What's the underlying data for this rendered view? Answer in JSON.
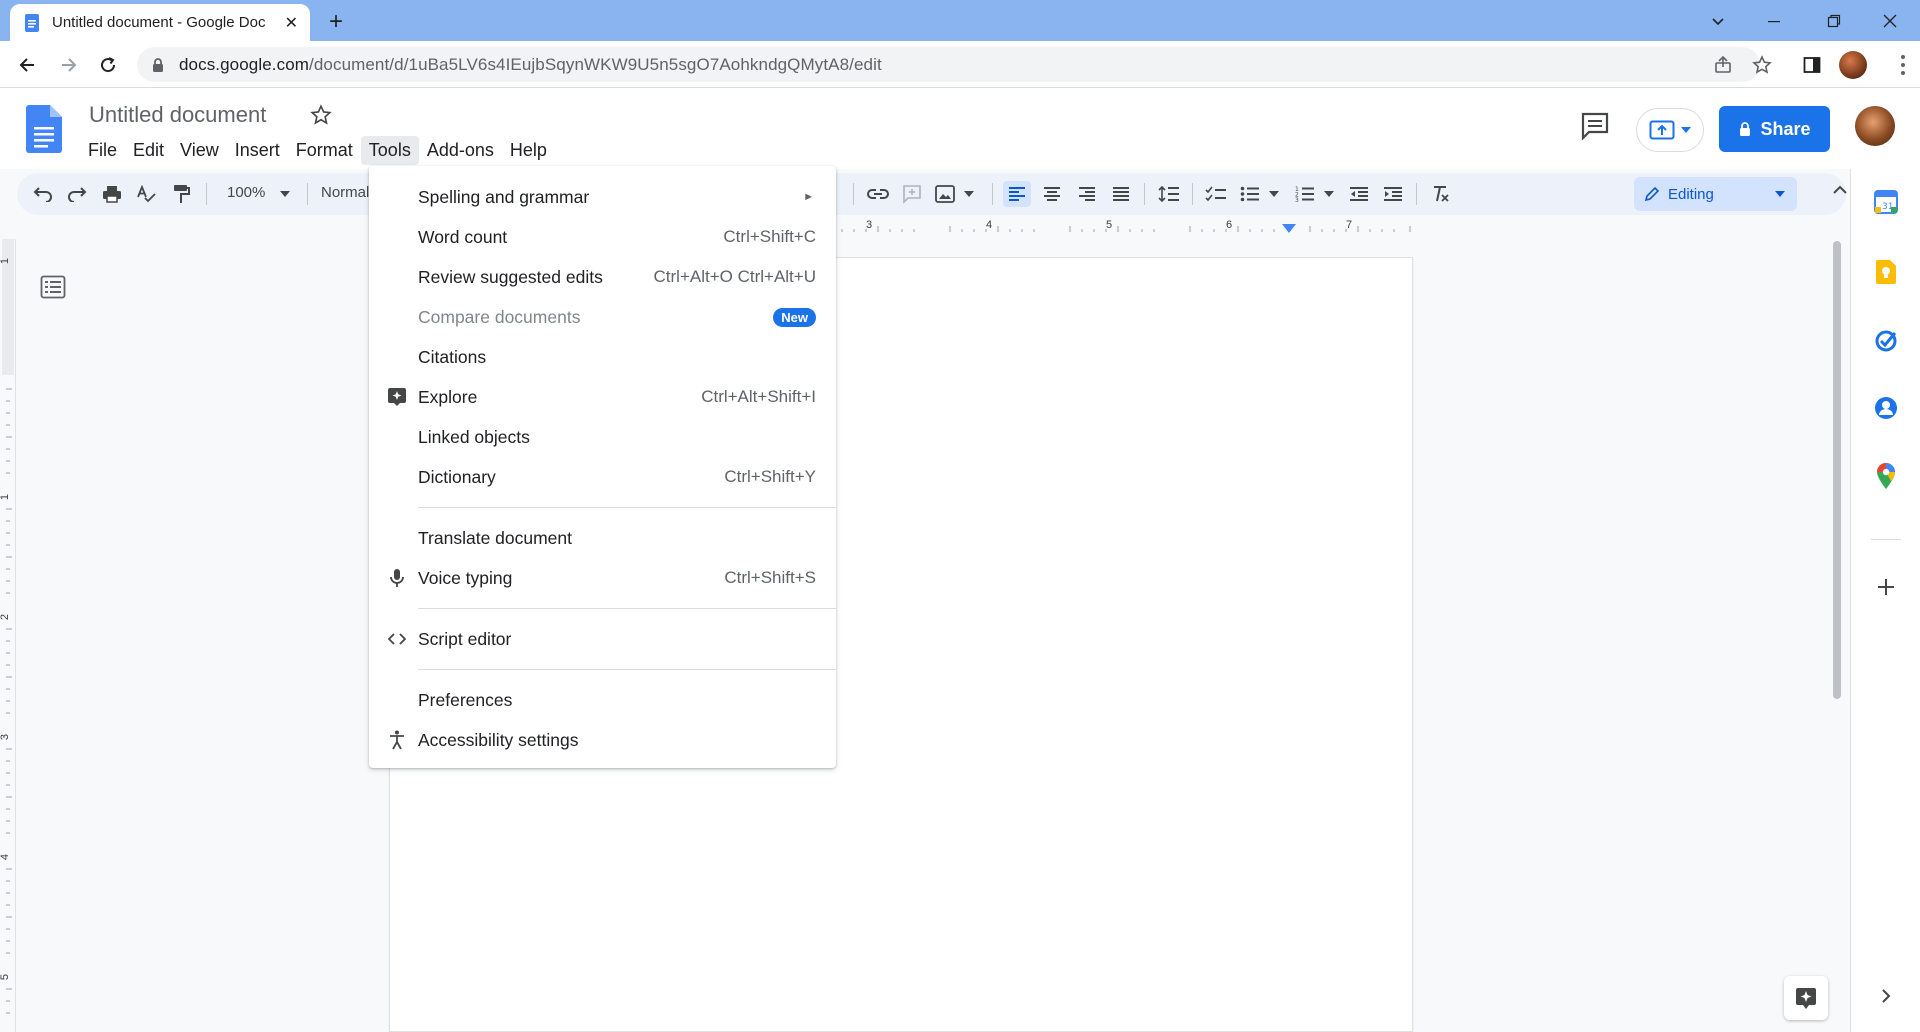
{
  "browser": {
    "tab_title": "Untitled document - Google Doc",
    "url_host": "docs.google.com",
    "url_path": "/document/d/1uBa5LV6s4IEujbSqynWKW9U5n5sgO7AohkndgQMytA8/edit"
  },
  "doc": {
    "title": "Untitled document",
    "menus": [
      "File",
      "Edit",
      "View",
      "Insert",
      "Format",
      "Tools",
      "Add-ons",
      "Help"
    ],
    "active_menu": "Tools",
    "share_label": "Share"
  },
  "toolbar": {
    "zoom": "100%",
    "style": "Normal",
    "mode": "Editing"
  },
  "ruler": {
    "h_labels": [
      "3",
      "4",
      "5",
      "6",
      "7"
    ],
    "v_labels": [
      "1",
      "1",
      "2",
      "3",
      "4",
      "5"
    ]
  },
  "tools_menu": {
    "items": [
      {
        "label": "Spelling and grammar",
        "shortcut": "",
        "submenu": true,
        "icon": ""
      },
      {
        "label": "Word count",
        "shortcut": "Ctrl+Shift+C",
        "icon": ""
      },
      {
        "label": "Review suggested edits",
        "shortcut": "Ctrl+Alt+O Ctrl+Alt+U",
        "icon": ""
      },
      {
        "label": "Compare documents",
        "badge": "New",
        "disabled": true,
        "icon": ""
      },
      {
        "label": "Citations",
        "shortcut": "",
        "icon": ""
      },
      {
        "label": "Explore",
        "shortcut": "Ctrl+Alt+Shift+I",
        "icon": "explore-icon"
      },
      {
        "label": "Linked objects",
        "shortcut": "",
        "icon": ""
      },
      {
        "label": "Dictionary",
        "shortcut": "Ctrl+Shift+Y",
        "icon": ""
      },
      {
        "label": "Translate document",
        "shortcut": "",
        "icon": ""
      },
      {
        "label": "Voice typing",
        "shortcut": "Ctrl+Shift+S",
        "icon": "microphone-icon"
      },
      {
        "label": "Script editor",
        "shortcut": "",
        "icon": "code-icon"
      },
      {
        "label": "Preferences",
        "shortcut": "",
        "icon": ""
      },
      {
        "label": "Accessibility settings",
        "shortcut": "",
        "icon": "accessibility-icon"
      }
    ]
  },
  "colors": {
    "accent": "#1a73e8",
    "tabstrip": "#8ab4f0",
    "toolbar_bg": "#edf2fa",
    "editing_bg": "#d3e3fd"
  }
}
